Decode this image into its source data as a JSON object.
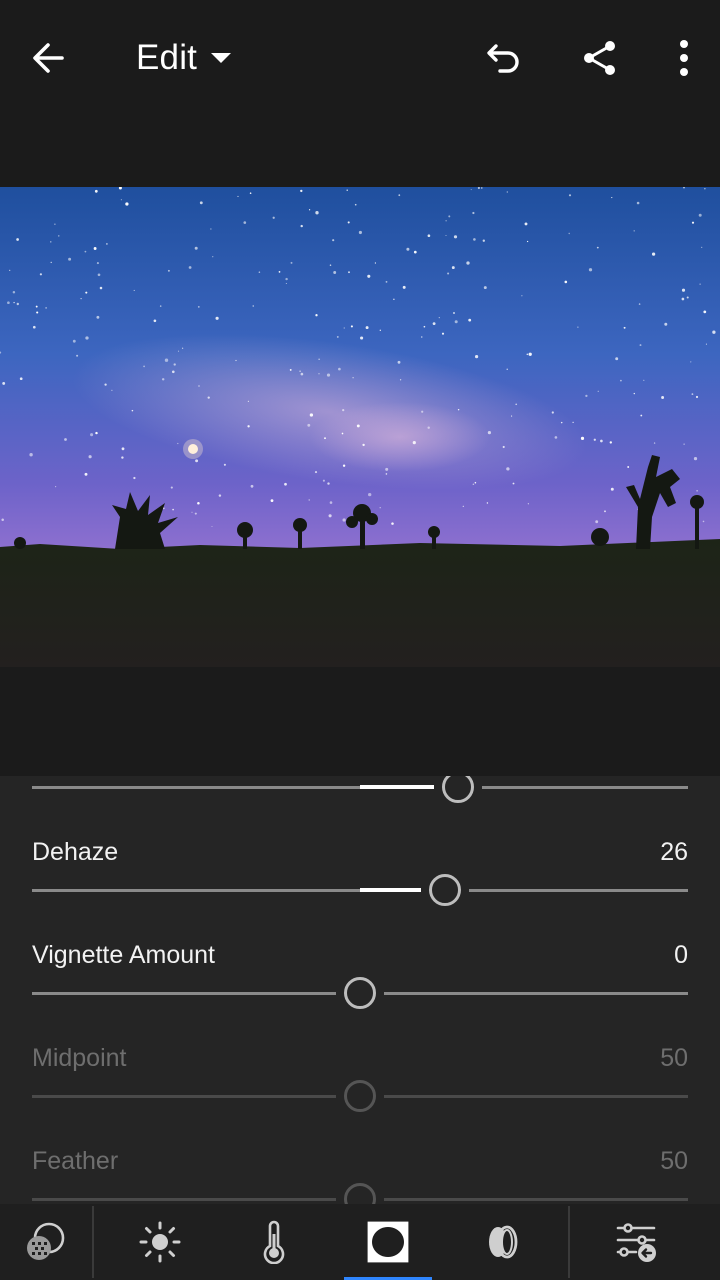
{
  "header": {
    "title": "Edit",
    "icons": [
      "back-arrow-icon",
      "chevron-down-icon",
      "undo-icon",
      "share-icon",
      "more-vertical-icon"
    ]
  },
  "photo": {
    "subject": "night sky with milky way and joshua tree silhouettes"
  },
  "panel": {
    "top_slider": {
      "fraction": 0.65
    },
    "sliders": [
      {
        "label": "Dehaze",
        "value": "26",
        "fraction": 0.63,
        "enabled": true
      },
      {
        "label": "Vignette Amount",
        "value": "0",
        "fraction": 0.5,
        "enabled": true
      },
      {
        "label": "Midpoint",
        "value": "50",
        "fraction": 0.5,
        "enabled": false
      },
      {
        "label": "Feather",
        "value": "50",
        "fraction": 0.5,
        "enabled": false
      }
    ]
  },
  "toolbar": {
    "tools": [
      {
        "name": "selective-edit-icon"
      },
      {
        "name": "light-icon"
      },
      {
        "name": "color-temperature-icon"
      },
      {
        "name": "effects-vignette-icon",
        "active": true
      },
      {
        "name": "detail-lens-icon"
      },
      {
        "name": "presets-adjust-icon"
      }
    ],
    "accent": "#2f86ff"
  }
}
